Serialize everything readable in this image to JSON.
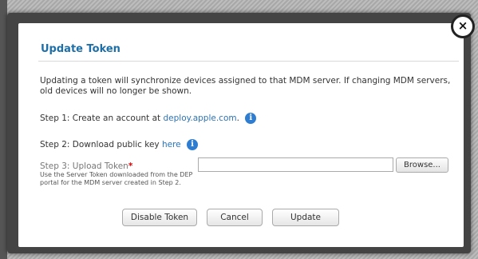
{
  "dialog": {
    "title": "Update Token",
    "description": "Updating a token will synchronize devices assigned to that MDM server. If changing MDM servers, old devices will no longer be shown.",
    "step1": {
      "text": "Step 1: Create an account at ",
      "link": "deploy.apple.com",
      "suffix": "."
    },
    "step2": {
      "text": "Step 2: Download public key ",
      "link": "here"
    },
    "step3": {
      "label": "Step 3: Upload Token",
      "required_mark": "*",
      "helper": "Use the Server Token downloaded from the DEP portal for the MDM server created in Step 2.",
      "file_value": "",
      "browse_label": "Browse..."
    },
    "buttons": {
      "disable": "Disable Token",
      "cancel": "Cancel",
      "update": "Update"
    },
    "close_symbol": "×",
    "info_symbol": "i"
  },
  "colors": {
    "title": "#1e6fa8",
    "link": "#2a73b8",
    "info_icon": "#2f7dd1",
    "required": "#dd0000"
  },
  "icons": [
    "close-icon",
    "info-icon"
  ]
}
